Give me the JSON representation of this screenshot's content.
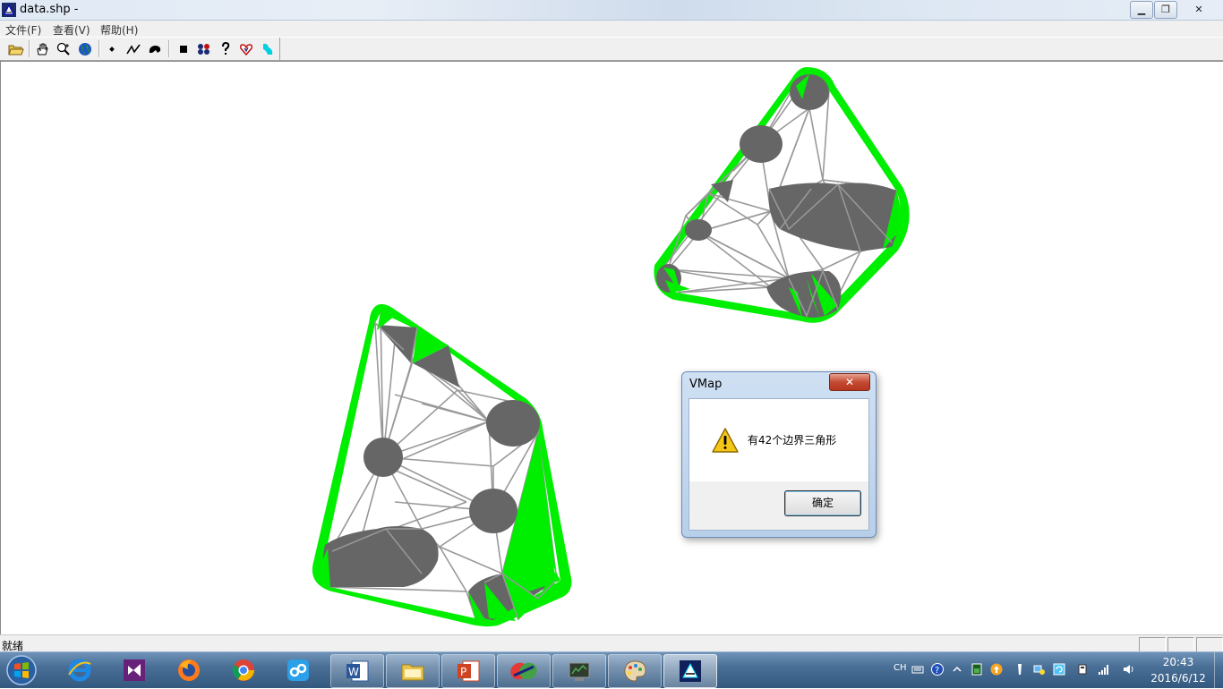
{
  "window": {
    "title": "data.shp - ",
    "minimize_label": "▁",
    "maximize_label": "❐",
    "close_label": "✕"
  },
  "menu": {
    "items": [
      {
        "label": "文件(F)"
      },
      {
        "label": "查看(V)"
      },
      {
        "label": "帮助(H)"
      }
    ]
  },
  "toolbar": {
    "groups": [
      [
        "open-folder-icon",
        "pan-hand-icon",
        "zoom-icon",
        "globe-icon"
      ],
      [
        "point-icon",
        "polyline-icon",
        "polygon-icon"
      ],
      [
        "square-icon",
        "triangulate-icon",
        "help-icon",
        "heart-icon",
        "boundary-icon"
      ]
    ]
  },
  "map": {
    "colors": {
      "boundary_fill": "#00ee00",
      "hole_fill": "#666666",
      "edge_stroke": "#999999",
      "hole_outline": "#0000aa"
    }
  },
  "dialog": {
    "title": "VMap",
    "close_label": "✕",
    "message": "有42个边界三角形",
    "ok_label": "确定",
    "icon": "warning-icon"
  },
  "statusbar": {
    "text": "就绪"
  },
  "taskbar": {
    "apps": [
      {
        "name": "internet-explorer-icon",
        "state": "pinned"
      },
      {
        "name": "visual-studio-icon",
        "state": "pinned"
      },
      {
        "name": "firefox-icon",
        "state": "pinned"
      },
      {
        "name": "chrome-icon",
        "state": "pinned"
      },
      {
        "name": "baidu-cloud-icon",
        "state": "pinned"
      },
      {
        "name": "word-icon",
        "state": "open"
      },
      {
        "name": "file-explorer-icon",
        "state": "open"
      },
      {
        "name": "powerpoint-icon",
        "state": "open"
      },
      {
        "name": "app-tool-icon",
        "state": "open"
      },
      {
        "name": "terminal-icon",
        "state": "open"
      },
      {
        "name": "paint-icon",
        "state": "open"
      },
      {
        "name": "vmap-icon",
        "state": "active"
      }
    ],
    "tray": {
      "language": "CH",
      "time": "20:43",
      "date": "2016/6/12"
    }
  }
}
